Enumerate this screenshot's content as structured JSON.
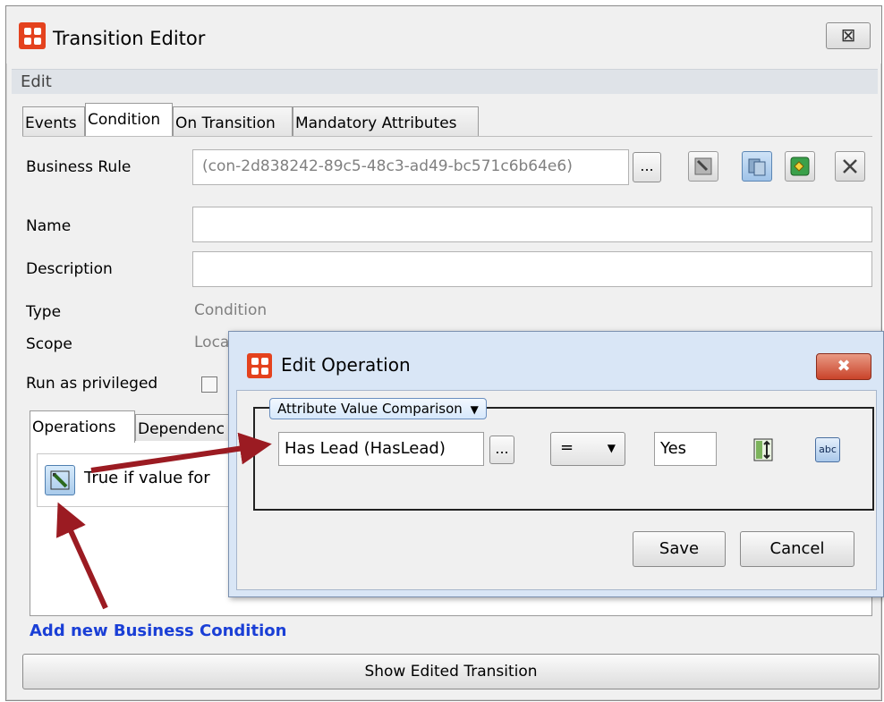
{
  "window": {
    "title": "Transition Editor",
    "close_glyph": "⊠"
  },
  "menu": {
    "edit": "Edit"
  },
  "tabs": [
    {
      "label": "Events"
    },
    {
      "label": "Condition"
    },
    {
      "label": "On Transition"
    },
    {
      "label": "Mandatory Attributes"
    }
  ],
  "form": {
    "business_rule_label": "Business Rule",
    "business_rule_value": "(con-2d838242-89c5-48c3-ad49-bc571c6b64e6)",
    "browse_label": "...",
    "name_label": "Name",
    "name_value": "",
    "description_label": "Description",
    "description_value": "",
    "type_label": "Type",
    "type_value": "Condition",
    "scope_label": "Scope",
    "scope_value": "Loca",
    "privileged_label": "Run as privileged"
  },
  "inner_tabs": [
    {
      "label": "Operations"
    },
    {
      "label": "Dependenc"
    }
  ],
  "operations": {
    "item_text": "True if value for"
  },
  "add_condition_link": "Add new Business Condition",
  "show_transition_button": "Show Edited Transition",
  "dialog": {
    "title": "Edit Operation",
    "close_glyph": "✖",
    "comparison_type": "Attribute Value Comparison",
    "attribute_value": "Has Lead (HasLead)",
    "browse_label": "...",
    "operator": "=",
    "compare_value": "Yes",
    "save_label": "Save",
    "cancel_label": "Cancel",
    "text_icon_label": "abc"
  },
  "colors": {
    "app_icon": "#e4421e",
    "arrow": "#9b1b22",
    "link": "#1a3fd6",
    "dialog_frame": "#d9e6f6"
  }
}
